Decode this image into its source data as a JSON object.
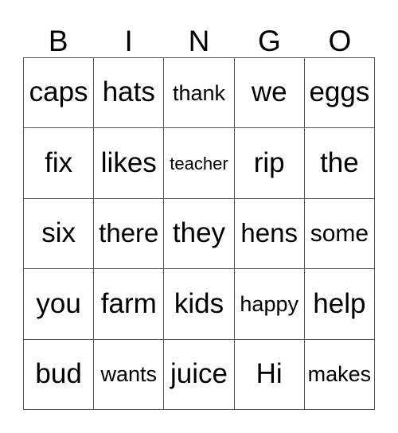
{
  "card": {
    "title": "Bingo Card",
    "background_color": "#ffffff",
    "text_color": "#000000",
    "border_color": "#555555"
  },
  "header": {
    "letters": [
      {
        "label": "B"
      },
      {
        "label": "I"
      },
      {
        "label": "N"
      },
      {
        "label": "G"
      },
      {
        "label": "O"
      }
    ]
  },
  "grid": {
    "columns": 5,
    "rows": 5,
    "cells": [
      {
        "text": "caps",
        "size": "size-xl"
      },
      {
        "text": "hats",
        "size": "size-xl"
      },
      {
        "text": "thank",
        "size": "size-sm"
      },
      {
        "text": "we",
        "size": "size-xl"
      },
      {
        "text": "eggs",
        "size": "size-xl"
      },
      {
        "text": "fix",
        "size": "size-xl"
      },
      {
        "text": "likes",
        "size": "size-xl"
      },
      {
        "text": "teacher",
        "size": "size-xs"
      },
      {
        "text": "rip",
        "size": "size-xl"
      },
      {
        "text": "the",
        "size": "size-xl"
      },
      {
        "text": "six",
        "size": "size-xl"
      },
      {
        "text": "there",
        "size": "size-lg"
      },
      {
        "text": "they",
        "size": "size-xl"
      },
      {
        "text": "hens",
        "size": "size-lg"
      },
      {
        "text": "some",
        "size": "size-md"
      },
      {
        "text": "you",
        "size": "size-xl"
      },
      {
        "text": "farm",
        "size": "size-xl"
      },
      {
        "text": "kids",
        "size": "size-xl"
      },
      {
        "text": "happy",
        "size": "size-sm"
      },
      {
        "text": "help",
        "size": "size-xl"
      },
      {
        "text": "bud",
        "size": "size-xl"
      },
      {
        "text": "wants",
        "size": "size-sm"
      },
      {
        "text": "juice",
        "size": "size-xl"
      },
      {
        "text": "Hi",
        "size": "size-xl"
      },
      {
        "text": "makes",
        "size": "size-sm"
      }
    ]
  }
}
